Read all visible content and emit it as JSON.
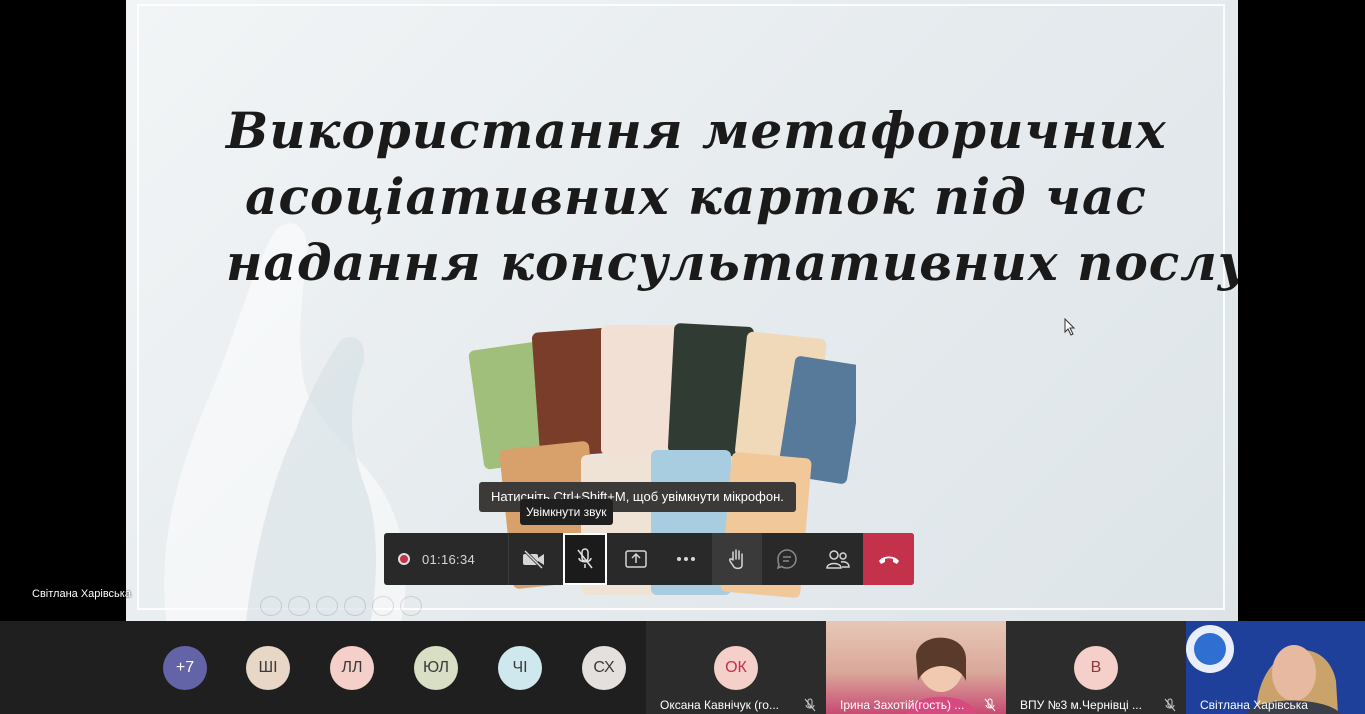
{
  "slide": {
    "title_lines": [
      "Використання метафоричних",
      "асоціативних карток під час",
      "надання консультативних послуг"
    ],
    "presenter_label": "Світлана Харівська"
  },
  "tooltips": {
    "hint": "Натисніть Ctrl+Shift+M, щоб увімкнути мікрофон.",
    "unmute": "Увімкнути звук"
  },
  "controls": {
    "recording_time": "01:16:34",
    "icons": [
      "record-icon",
      "camera-off-icon",
      "mic-off-icon",
      "share-screen-icon",
      "more-icon",
      "raise-hand-icon",
      "chat-icon",
      "participants-icon",
      "hang-up-icon"
    ]
  },
  "participants": {
    "overflow": "+7",
    "avatars": [
      {
        "initials": "ШІ",
        "color": "#e8d6c6"
      },
      {
        "initials": "ЛЛ",
        "color": "#f5cfc9"
      },
      {
        "initials": "ЮЛ",
        "color": "#d9dfc5"
      },
      {
        "initials": "ЧІ",
        "color": "#cfe8ee"
      },
      {
        "initials": "СХ",
        "color": "#e4e0de"
      }
    ],
    "tiles": [
      {
        "initials": "ОК",
        "name": "Оксана Кавнічук (го..."
      },
      {
        "name": "Ірина Захотій(гость) ..."
      },
      {
        "initials": "В",
        "name": "ВПУ №3 м.Чернівці ..."
      },
      {
        "name": "Світлана Харівська"
      }
    ]
  },
  "colors": {
    "accent": "#6264a7",
    "hangup": "#c4314b",
    "background": "#201f1f"
  }
}
